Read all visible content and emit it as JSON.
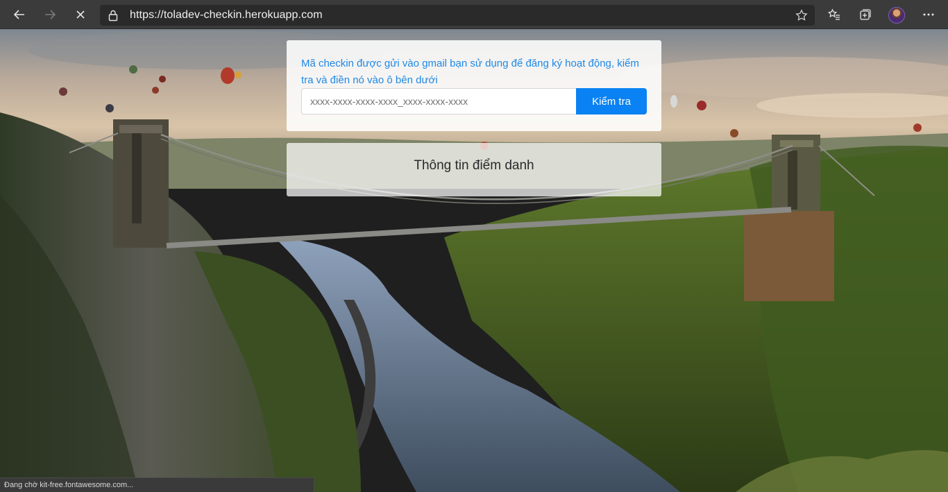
{
  "browser": {
    "url": "https://toladev-checkin.herokuapp.com",
    "status_text": "Đang chờ kit-free.fontawesome.com...",
    "icons": [
      "back-icon",
      "forward-icon",
      "stop-icon",
      "lock-icon",
      "star-icon",
      "favorites-icon",
      "collections-icon",
      "profile-avatar",
      "more-icon"
    ]
  },
  "checkin": {
    "message": "Mã checkin được gửi vào gmail bạn sử dụng để đăng ký hoạt động, kiểm tra và điền nó vào ô bên dưới",
    "code_placeholder": "xxxx-xxxx-xxxx-xxxx_xxxx-xxxx-xxxx",
    "check_button": "Kiểm tra"
  },
  "info": {
    "heading": "Thông tin điểm danh"
  },
  "colors": {
    "accent": "#0b82f3",
    "message_text": "#1e88e5",
    "toolbar": "#3b3b3b"
  }
}
